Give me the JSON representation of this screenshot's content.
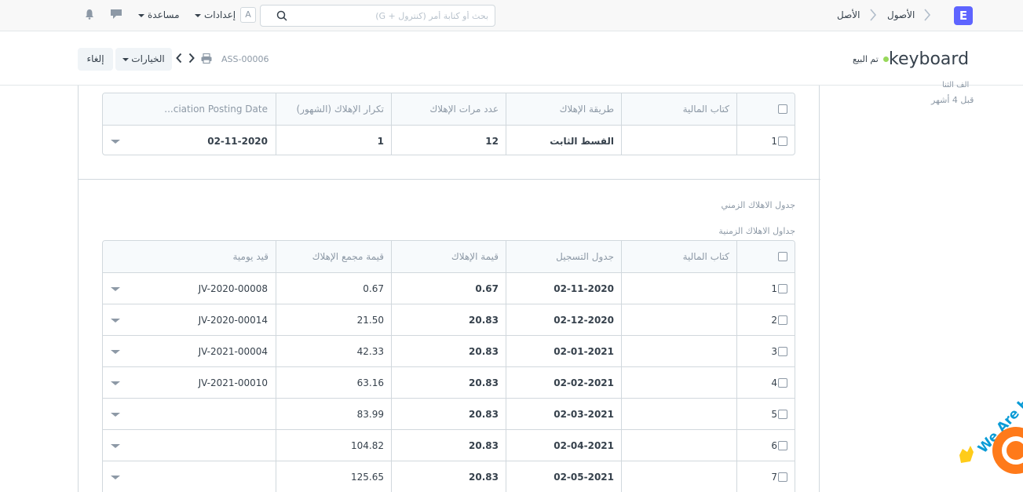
{
  "navbar": {
    "logo_letter": "E",
    "breadcrumbs": [
      "الأصول",
      "الأصل"
    ],
    "search_placeholder": "بحث أو كتابة أمر (كنترول + G)",
    "user_initial": "A",
    "settings_label": "إعدادات",
    "help_label": "مساعدة",
    "icons": [
      "search-icon",
      "chat-icon",
      "bell-icon",
      "chevron-right-icon"
    ]
  },
  "page_head": {
    "title": "keyboard",
    "status": "تم البيع",
    "status_color": "#98d85b",
    "doc_name": "ASS-00006",
    "options_label": "الخيارات",
    "cancel_label": "إلغاء"
  },
  "sidebar": {
    "cut_text": "آلف الثنا",
    "time_ago": "قبل 4 أشهر"
  },
  "finance_table": {
    "columns": [
      "كتاب المالية",
      "طريقة الإهلاك",
      "عدد مرات الإهلاك",
      "تكرار الإهلاك (الشهور)",
      "...ciation Posting Date"
    ],
    "rows": [
      {
        "idx": "1",
        "finance_book": "",
        "method": "القسط الثابت",
        "count": "12",
        "frequency": "1",
        "posting_date": "02-11-2020"
      }
    ]
  },
  "schedule_section": {
    "section_title": "جدول الاهلاك الزمني",
    "table_label": "جداول الاهلاك الزمنية",
    "columns": [
      "كتاب المالية",
      "جدول التسجيل",
      "قيمة الإهلاك",
      "قيمة مجمع الإهلاك",
      "قيد يومية"
    ],
    "rows": [
      {
        "idx": "1",
        "finance_book": "",
        "schedule_date": "02-11-2020",
        "amount": "0.67",
        "accumulated": "0.67",
        "journal": "JV-2020-00008"
      },
      {
        "idx": "2",
        "finance_book": "",
        "schedule_date": "02-12-2020",
        "amount": "20.83",
        "accumulated": "21.50",
        "journal": "JV-2020-00014"
      },
      {
        "idx": "3",
        "finance_book": "",
        "schedule_date": "02-01-2021",
        "amount": "20.83",
        "accumulated": "42.33",
        "journal": "JV-2021-00004"
      },
      {
        "idx": "4",
        "finance_book": "",
        "schedule_date": "02-02-2021",
        "amount": "20.83",
        "accumulated": "63.16",
        "journal": "JV-2021-00010"
      },
      {
        "idx": "5",
        "finance_book": "",
        "schedule_date": "02-03-2021",
        "amount": "20.83",
        "accumulated": "83.99",
        "journal": ""
      },
      {
        "idx": "6",
        "finance_book": "",
        "schedule_date": "02-04-2021",
        "amount": "20.83",
        "accumulated": "104.82",
        "journal": ""
      },
      {
        "idx": "7",
        "finance_book": "",
        "schedule_date": "02-05-2021",
        "amount": "20.83",
        "accumulated": "125.65",
        "journal": ""
      }
    ]
  },
  "chat_widget": {
    "text": "We Are H",
    "accent": "#ff7a1a"
  }
}
